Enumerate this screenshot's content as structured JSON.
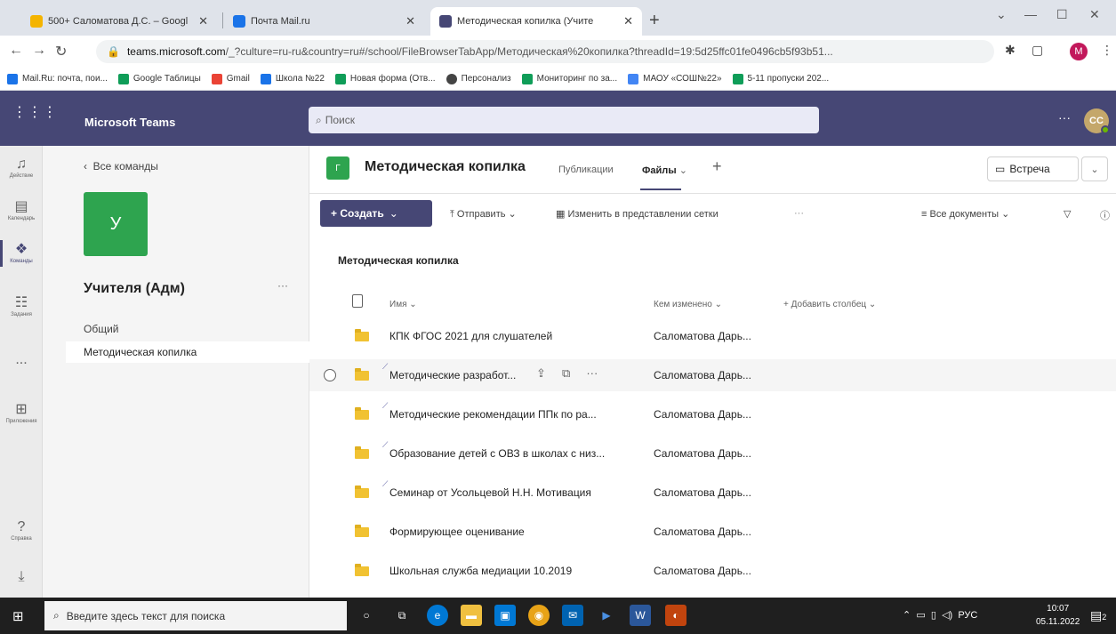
{
  "browser": {
    "tabs": [
      {
        "title": "500+ Саломатова Д.С. – Googl",
        "favicon_color": "#f4b400"
      },
      {
        "title": "Почта Mail.ru",
        "favicon_color": "#1a73e8"
      },
      {
        "title": "Методическая копилка (Учите",
        "favicon_color": "#464775"
      }
    ],
    "new_tab": "+",
    "url_host": "teams.microsoft.com",
    "url_rest": "/_?culture=ru-ru&country=ru#/school/FileBrowserTabApp/Методическая%20копилка?threadId=19:5d25ffc01fe0496cb5f93b51...",
    "profile_initial": "M",
    "bookmarks": [
      {
        "label": "Mail.Ru: почта, пои...",
        "color": "#1a73e8"
      },
      {
        "label": "Google Таблицы",
        "color": "#0f9d58"
      },
      {
        "label": "Gmail",
        "color": "#ea4335"
      },
      {
        "label": "Школа №22",
        "color": "#1a73e8"
      },
      {
        "label": "Новая форма (Отв...",
        "color": "#0f9d58"
      },
      {
        "label": "Персонализ",
        "color": "#444444"
      },
      {
        "label": "Мониторинг по за...",
        "color": "#0f9d58"
      },
      {
        "label": "МАОУ «СОШ№22»",
        "color": "#4285f4"
      },
      {
        "label": "5-11 пропуски 202...",
        "color": "#0f9d58"
      }
    ]
  },
  "teams": {
    "app_name": "Microsoft Teams",
    "search_placeholder": "Поиск",
    "avatar_initials": "CC",
    "rail": [
      {
        "label": "Действие",
        "icon": "bell-icon"
      },
      {
        "label": "Календарь",
        "icon": "calendar-icon"
      },
      {
        "label": "Команды",
        "icon": "teams-icon"
      },
      {
        "label": "Задания",
        "icon": "assignments-icon"
      },
      {
        "label": "...",
        "icon": "more-icon"
      },
      {
        "label": "Приложения",
        "icon": "apps-icon"
      },
      {
        "label": "Справка",
        "icon": "help-icon"
      },
      {
        "label": "",
        "icon": "download-icon"
      }
    ],
    "panel": {
      "back": "Все команды",
      "tile_letter": "У",
      "team_name": "Учителя (Адм)",
      "more": "···",
      "channels": [
        "Общий",
        "Методическая копилка"
      ]
    },
    "channel": {
      "icon_letter": "Г",
      "title": "Методическая копилка",
      "tabs": [
        "Публикации",
        "Файлы"
      ],
      "meet": "Встреча"
    },
    "toolbar": {
      "create": "+ Создать",
      "upload": "Отправить",
      "grid": "Изменить в представлении сетки",
      "more": "···",
      "all_docs": "Все документы"
    },
    "library_title": "Методическая копилка",
    "columns": {
      "name": "Имя",
      "modified_by": "Кем изменено",
      "add_column": "+ Добавить столбец"
    },
    "files": [
      {
        "name": "КПК ФГОС 2021 для слушателей",
        "modified_by": "Саломатова Дарь...",
        "synced": false
      },
      {
        "name": "Методические разработ...",
        "modified_by": "Саломатова Дарь...",
        "synced": true
      },
      {
        "name": "Методические рекомендации ППк по ра...",
        "modified_by": "Саломатова Дарь...",
        "synced": true
      },
      {
        "name": "Образование детей с ОВЗ в школах с низ...",
        "modified_by": "Саломатова Дарь...",
        "synced": true
      },
      {
        "name": "Семинар от Усольцевой Н.Н. Мотивация",
        "modified_by": "Саломатова Дарь...",
        "synced": true
      },
      {
        "name": "Формирующее оценивание",
        "modified_by": "Саломатова Дарь...",
        "synced": false
      },
      {
        "name": "Школьная служба медиации 10.2019",
        "modified_by": "Саломатова Дарь...",
        "synced": false
      }
    ]
  },
  "taskbar": {
    "search_placeholder": "Введите здесь текст для поиска",
    "lang": "РУС",
    "time": "10:07",
    "date": "05.11.2022",
    "notifications": "2"
  }
}
